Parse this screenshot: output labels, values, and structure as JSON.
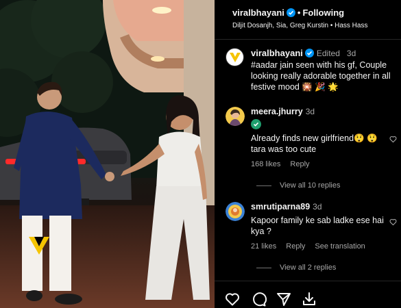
{
  "header": {
    "username": "viralbhayani",
    "follow_label": "Following",
    "audio": "Diljit Dosanjh, Sia, Greg Kurstin • Hass Hass"
  },
  "caption": {
    "username": "viralbhayani",
    "edited_label": "Edited",
    "time": "3d",
    "text": "#aadar jain seen with his gf, Couple looking really adorable together in all festive mood 🎇 🎉 🌟"
  },
  "comments": [
    {
      "username": "meera.jhurry",
      "time": "3d",
      "text_line1": "Already finds new girlfriend😲 😲",
      "text_line2": "tara was too cute",
      "likes": "168 likes",
      "reply_label": "Reply",
      "view_replies": "View all 10 replies"
    },
    {
      "username": "smrutiparna89",
      "time": "3d",
      "text": "Kapoor family ke sab ladke ese hai kya ?",
      "likes": "21 likes",
      "reply_label": "Reply",
      "translation_label": "See translation",
      "view_replies": "View all 2 replies"
    }
  ],
  "actions": {
    "icons": [
      "heart-icon",
      "comment-icon",
      "share-icon",
      "save-icon"
    ]
  },
  "colors": {
    "verified": "#0095f6",
    "muted": "#a8a8a8",
    "logo_yellow": "#f5c400"
  }
}
